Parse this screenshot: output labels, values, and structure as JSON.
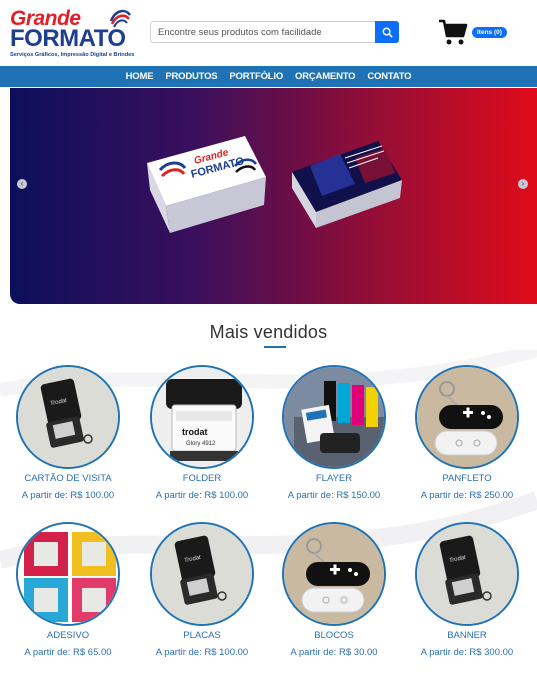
{
  "brand": {
    "logo_top": "Grande",
    "logo_bottom": "FORMATO",
    "logo_sub": "Serviços Gráficos, Impressão Digital e Brindes",
    "colors": {
      "red": "#e01f26",
      "navy": "#1e3f8f"
    }
  },
  "search": {
    "placeholder": "Encontre seus produtos com facilidade",
    "icon": "search-icon"
  },
  "cart": {
    "icon": "cart-icon",
    "badge": "Itens (0)"
  },
  "nav": {
    "items": [
      "HOME",
      "PRODUTOS",
      "PORTFÓLIO",
      "ORÇAMENTO",
      "CONTATO"
    ],
    "color": "#1f73b5"
  },
  "banner": {
    "prev_icon": "chevron-left-icon",
    "next_icon": "chevron-right-icon"
  },
  "best_sellers": {
    "title": "Mais vendidos",
    "products": [
      {
        "name": "CARTÃO DE VISITA",
        "price": "A partir de: R$ 100.00",
        "image": "stamp"
      },
      {
        "name": "FOLDER",
        "price": "A partir de: R$ 100.00",
        "image": "trodat"
      },
      {
        "name": "FLAYER",
        "price": "A partir de: R$ 150.00",
        "image": "ink"
      },
      {
        "name": "PANFLETO",
        "price": "A partir de: R$ 250.00",
        "image": "keychain"
      },
      {
        "name": "ADESIVO",
        "price": "A partir de: R$ 65.00",
        "image": "frames"
      },
      {
        "name": "PLACAS",
        "price": "A partir de: R$ 100.00",
        "image": "stamp"
      },
      {
        "name": "BLOCOS",
        "price": "A partir de: R$ 30.00",
        "image": "keychain"
      },
      {
        "name": "BANNER",
        "price": "A partir de: R$ 300.00",
        "image": "stamp"
      }
    ]
  }
}
